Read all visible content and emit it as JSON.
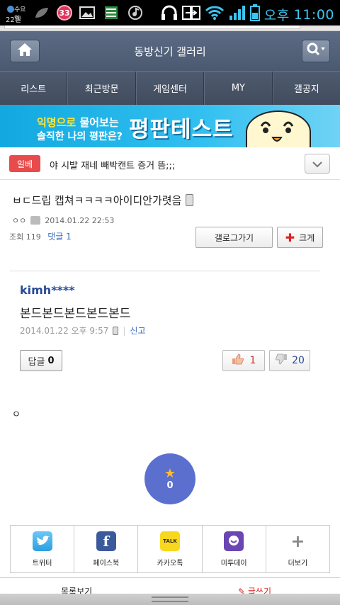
{
  "status_bar": {
    "date_day": "수요일",
    "date_num": "22일",
    "notification_count": "33",
    "ampm": "오후",
    "time": "11:00"
  },
  "header": {
    "title": "동방신기 갤러리"
  },
  "nav": {
    "items": [
      "리스트",
      "최근방문",
      "게임센터",
      "MY",
      "갤공지"
    ]
  },
  "banner": {
    "line1_a": "익명으로",
    "line1_b": "물어보는",
    "line2": "솔직한 나의 평판은?",
    "headline": "평판테스트"
  },
  "hot_bar": {
    "tag": "일베",
    "text": "야 시발 재네 빼박캔트 증거 뜸;;;"
  },
  "post": {
    "title": "ㅂㄷ드립 캡쳐ㅋㅋㅋㅋ아이디안가렷음",
    "author": "ㅇㅇ",
    "datetime": "2014.01.22 22:53",
    "views": "조회 119",
    "comments_link": "댓글 1",
    "gallery_button": "갤로그가기",
    "big_button": "크게"
  },
  "comment": {
    "author": "kimh****",
    "body": "본드본드본드본드본드",
    "datetime": "2014.01.22 오후 9:57",
    "report": "신고",
    "reply_label": "답글",
    "reply_count": "0",
    "upvotes": "1",
    "downvotes": "20"
  },
  "body_text": "ㅇ",
  "medal": {
    "count": "0"
  },
  "share": {
    "items": [
      {
        "label": "트위터",
        "icon": "twitter-icon"
      },
      {
        "label": "페이스북",
        "icon": "facebook-icon"
      },
      {
        "label": "카카오톡",
        "icon": "kakaotalk-icon"
      },
      {
        "label": "미투데이",
        "icon": "me2day-icon"
      },
      {
        "label": "더보기",
        "icon": "plus-icon"
      }
    ],
    "kakao_text": "TALK"
  },
  "bottom_bar": {
    "left": "목록보기",
    "right": "글쓰기"
  },
  "colors": {
    "header_bg": "#4b5970",
    "nav_bg": "#414c5e",
    "banner_bg": "#12a8e0",
    "tag_red": "#e84b4b",
    "author_blue": "#2a4b9a",
    "medal_bg": "#5b6fcf"
  }
}
